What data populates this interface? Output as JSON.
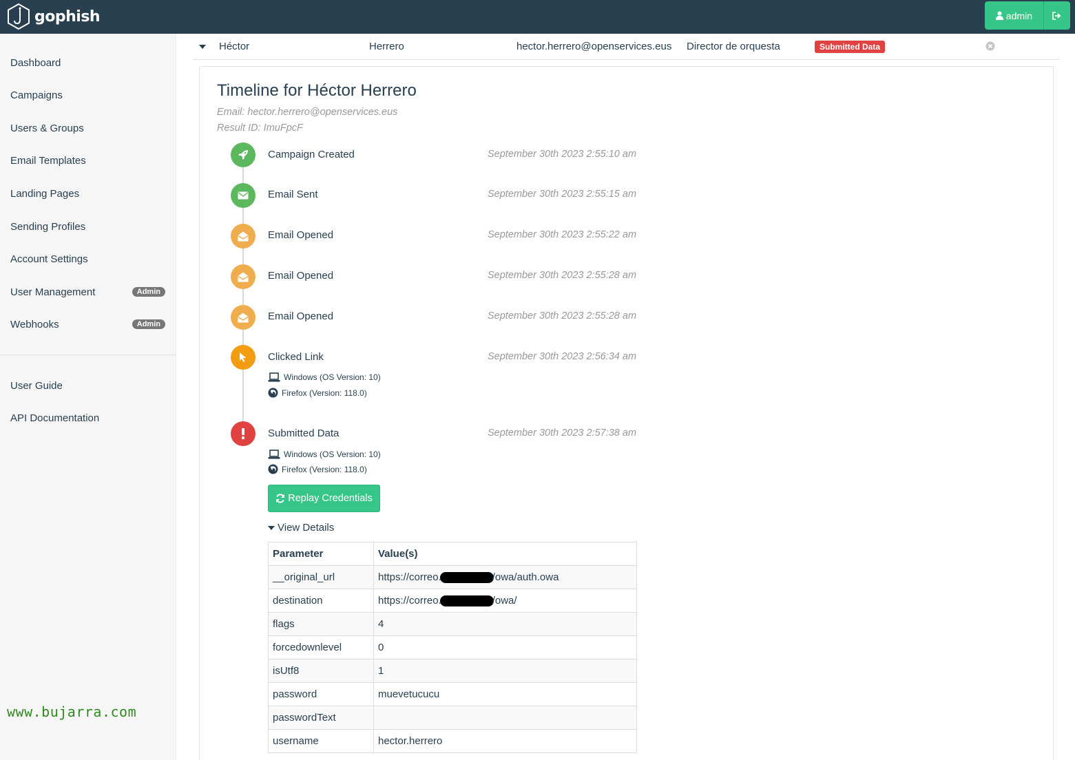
{
  "navbar": {
    "brand": "gophish",
    "user_label": "admin",
    "colors": {
      "bar": "#283f50",
      "accent": "#37c68a"
    },
    "icons": [
      "gophish-logo-icon",
      "user-icon",
      "logout-icon"
    ]
  },
  "sidebar": {
    "items": [
      {
        "label": "Dashboard"
      },
      {
        "label": "Campaigns"
      },
      {
        "label": "Users & Groups"
      },
      {
        "label": "Email Templates"
      },
      {
        "label": "Landing Pages"
      },
      {
        "label": "Sending Profiles"
      },
      {
        "label": "Account Settings"
      },
      {
        "label": "User Management",
        "badge": "Admin"
      },
      {
        "label": "Webhooks",
        "badge": "Admin"
      }
    ],
    "secondary_items": [
      {
        "label": "User Guide"
      },
      {
        "label": "API Documentation"
      }
    ],
    "watermark": "www.bujarra.com"
  },
  "result_row": {
    "first_name": "Héctor",
    "last_name": "Herrero",
    "email": "hector.herrero@openservices.eus",
    "position": "Director de orquesta",
    "status": "Submitted Data",
    "status_color": "#e04141"
  },
  "timeline": {
    "title": "Timeline for Héctor Herrero",
    "email_line": "Email: hector.herrero@openservices.eus",
    "result_id_line": "Result ID: ImuFpcF",
    "events": [
      {
        "label": "Campaign Created",
        "date": "September 30th 2023 2:55:10 am",
        "icon": "rocket-icon",
        "color": "#5cb85c"
      },
      {
        "label": "Email Sent",
        "date": "September 30th 2023 2:55:15 am",
        "icon": "envelope-icon",
        "color": "#5cb85c"
      },
      {
        "label": "Email Opened",
        "date": "September 30th 2023 2:55:22 am",
        "icon": "envelope-open-icon",
        "color": "#f0ad4e"
      },
      {
        "label": "Email Opened",
        "date": "September 30th 2023 2:55:28 am",
        "icon": "envelope-open-icon",
        "color": "#f0ad4e"
      },
      {
        "label": "Email Opened",
        "date": "September 30th 2023 2:55:28 am",
        "icon": "envelope-open-icon",
        "color": "#f0ad4e"
      },
      {
        "label": "Clicked Link",
        "date": "September 30th 2023 2:56:34 am",
        "icon": "mouse-pointer-icon",
        "color": "#f39c12",
        "os": "Windows (OS Version: 10)",
        "browser": "Firefox (Version: 118.0)"
      },
      {
        "label": "Submitted Data",
        "date": "September 30th 2023 2:57:38 am",
        "icon": "exclamation-icon",
        "color": "#e04141",
        "os": "Windows (OS Version: 10)",
        "browser": "Firefox (Version: 118.0)"
      }
    ],
    "replay_button": "Replay Credentials",
    "view_details": "View Details"
  },
  "details_table": {
    "headers": [
      "Parameter",
      "Value(s)"
    ],
    "rows": [
      {
        "param": "__original_url",
        "value_prefix": "https://correo.",
        "value_suffix": "/owa/auth.owa",
        "redacted": true
      },
      {
        "param": "destination",
        "value_prefix": "https://correo.",
        "value_suffix": "/owa/",
        "redacted": true
      },
      {
        "param": "flags",
        "value": "4"
      },
      {
        "param": "forcedownlevel",
        "value": "0"
      },
      {
        "param": "isUtf8",
        "value": "1"
      },
      {
        "param": "password",
        "value": "muevetucucu"
      },
      {
        "param": "passwordText",
        "value": ""
      },
      {
        "param": "username",
        "value": "hector.herrero"
      }
    ]
  }
}
